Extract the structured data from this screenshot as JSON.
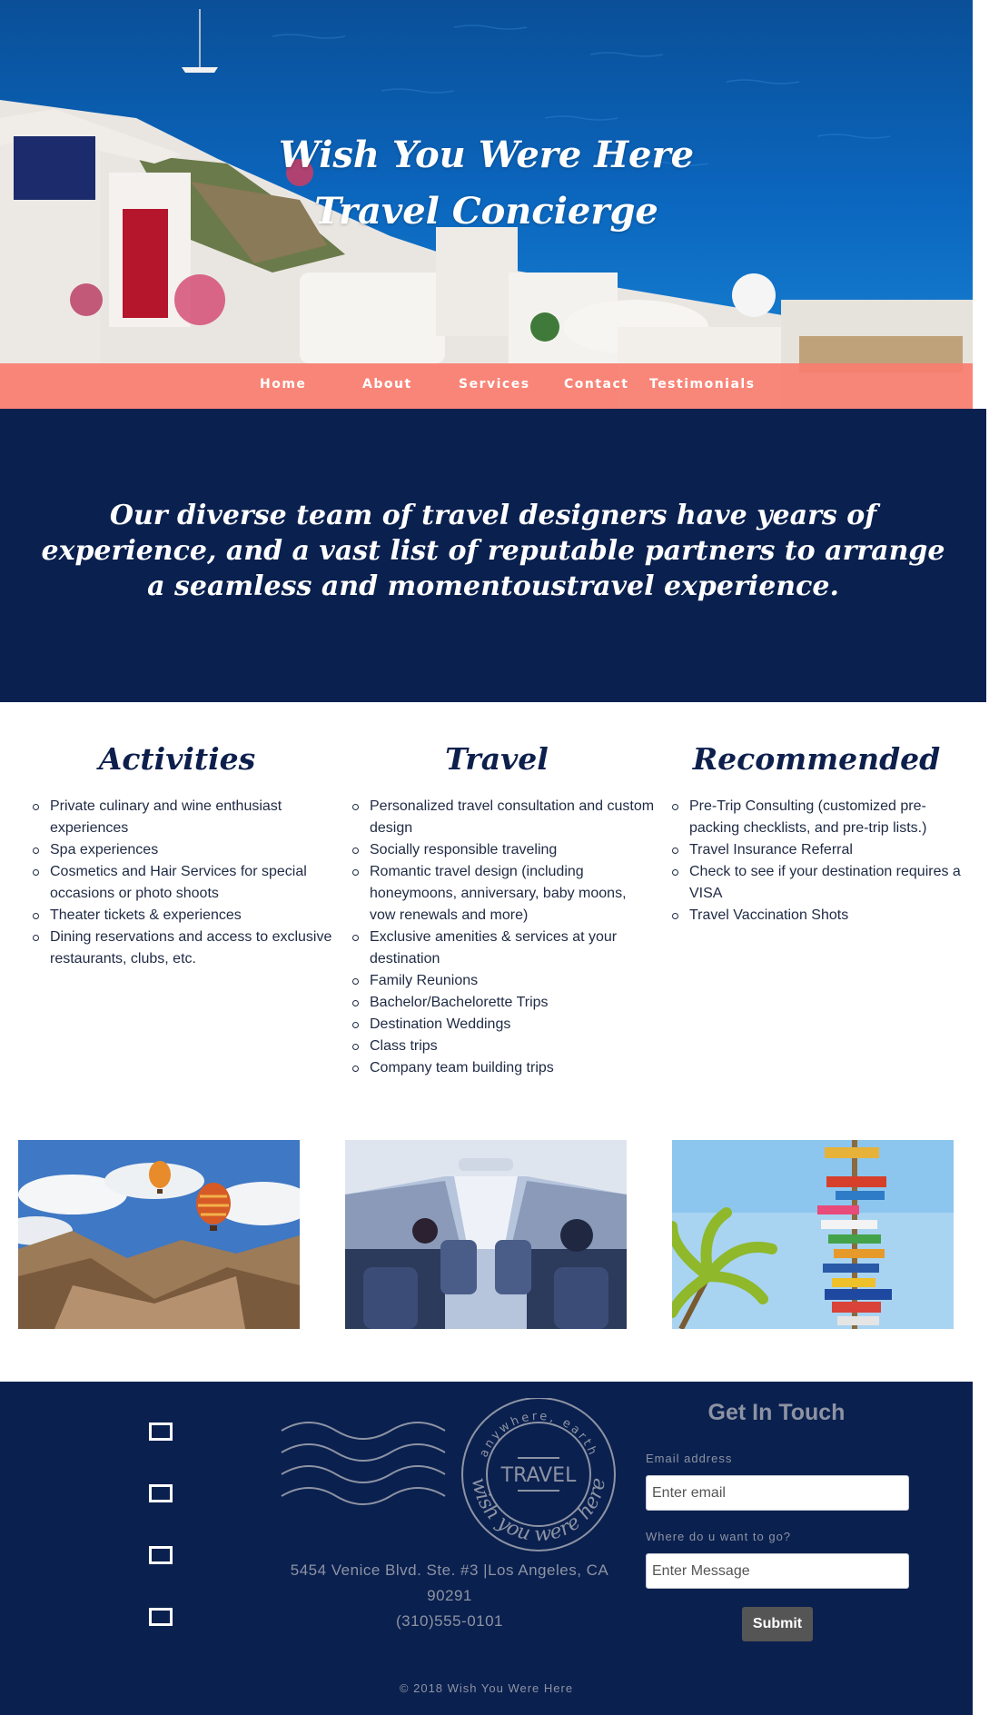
{
  "hero": {
    "title_line1": "Wish You Were Here",
    "title_line2": "Travel Concierge"
  },
  "nav": {
    "items": [
      {
        "label": "Home"
      },
      {
        "label": "About"
      },
      {
        "label": "Services"
      },
      {
        "label": "Contact"
      },
      {
        "label": "Testimonials"
      }
    ]
  },
  "mission": {
    "text": "Our diverse team of travel designers have years of experience, and a vast list of reputable partners to arrange a seamless and momentoustravel experience."
  },
  "columns": [
    {
      "title": "Activities",
      "items": [
        "Private culinary and wine enthusiast experiences",
        "Spa experiences",
        "Cosmetics and Hair Services for special occasions or photo shoots",
        "Theater tickets & experiences",
        "Dining reservations and access to exclusive restaurants, clubs, etc."
      ]
    },
    {
      "title": "Travel",
      "items": [
        "Personalized travel consultation and custom design",
        "Socially responsible traveling",
        "Romantic travel design (including honeymoons, anniversary, baby moons, vow renewals and more)",
        "Exclusive amenities & services at your destination",
        "Family Reunions",
        "Bachelor/Bachelorette Trips",
        "Destination Weddings",
        "Class trips",
        "Company team building trips"
      ]
    },
    {
      "title": "Recommended",
      "items": [
        "Pre-Trip Consulting (customized pre-packing checklists, and pre-trip lists.)",
        "Travel Insurance Referral",
        "Check to see if your destination requires a VISA",
        "Travel Vaccination Shots"
      ]
    }
  ],
  "photos": [
    {
      "icon": "hot-air-balloons-photo"
    },
    {
      "icon": "airplane-cabin-photo"
    },
    {
      "icon": "signpost-palm-photo"
    }
  ],
  "footer": {
    "stamp": {
      "top_text": "anywhere, earth",
      "center_text": "TRAVEL",
      "bottom_text": "wish you were here"
    },
    "address_line1": "5454 Venice Blvd. Ste. #3 |Los Angeles, CA",
    "address_line2": "90291",
    "phone": "(310)555-0101",
    "form": {
      "title": "Get In Touch",
      "email_label": "Email address",
      "email_placeholder": "Enter email",
      "dest_label": "Where do u want to go?",
      "dest_placeholder": "Enter Message",
      "submit_label": "Submit"
    },
    "copyright": "© 2018 Wish You Were Here"
  },
  "colors": {
    "navy": "#0a204f",
    "coral": "#f97d6f",
    "muted_text": "#8d93a3",
    "submit_bg": "#555555"
  }
}
